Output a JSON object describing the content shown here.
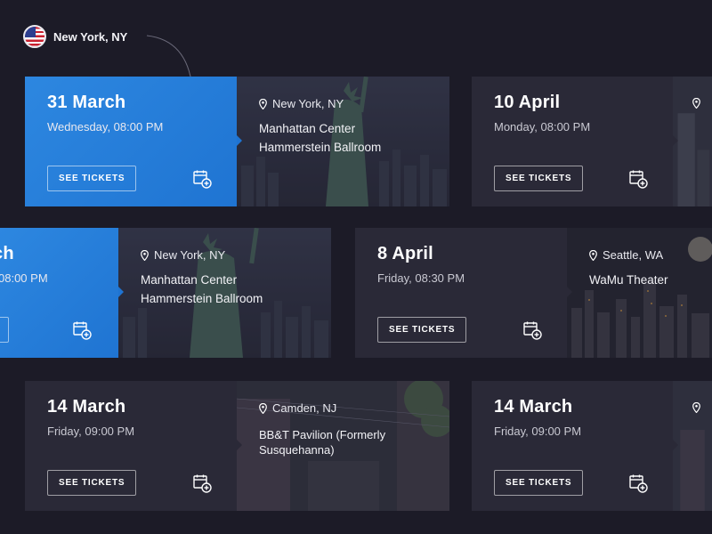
{
  "location_selector": {
    "city": "New York, NY",
    "flag_icon": "us-flag-icon"
  },
  "cards": [
    {
      "date": "31 March",
      "time": "Wednesday, 08:00 PM",
      "button": "SEE TICKETS",
      "place": "New York, NY",
      "venue_line1": "Manhattan Center",
      "venue_line2": "Hammerstein Ballroom",
      "state": "active"
    },
    {
      "date": "10 April",
      "time": "Monday, 08:00 PM",
      "button": "SEE TICKETS",
      "place": "",
      "venue_line1": "",
      "venue_line2": "",
      "state": "dim"
    },
    {
      "date": "",
      "time": "08:00 PM",
      "button": "",
      "place": "New York, NY",
      "venue_line1": "Manhattan Center",
      "venue_line2": "Hammerstein Ballroom",
      "state": "active"
    },
    {
      "date": "8 April",
      "time": "Friday, 08:30 PM",
      "button": "SEE TICKETS",
      "place": "Seattle, WA",
      "venue_line1": "WaMu Theater",
      "venue_line2": "",
      "state": "dim"
    },
    {
      "date": "14 March",
      "time": "Friday, 09:00 PM",
      "button": "SEE TICKETS",
      "place": "Camden, NJ",
      "venue_line1": "BB&T Pavilion (Formerly Susquehanna)",
      "venue_line2": "",
      "state": "dim"
    },
    {
      "date": "14 March",
      "time": "Friday, 09:00 PM",
      "button": "SEE TICKETS",
      "place": "",
      "venue_line1": "",
      "venue_line2": "",
      "state": "dim"
    }
  ],
  "colors": {
    "background": "#1c1b27",
    "accent": "#1f74d2",
    "card_dim": "#2a2937"
  },
  "icons": {
    "calendar": "calendar-add-icon",
    "location": "location-pin-icon"
  }
}
